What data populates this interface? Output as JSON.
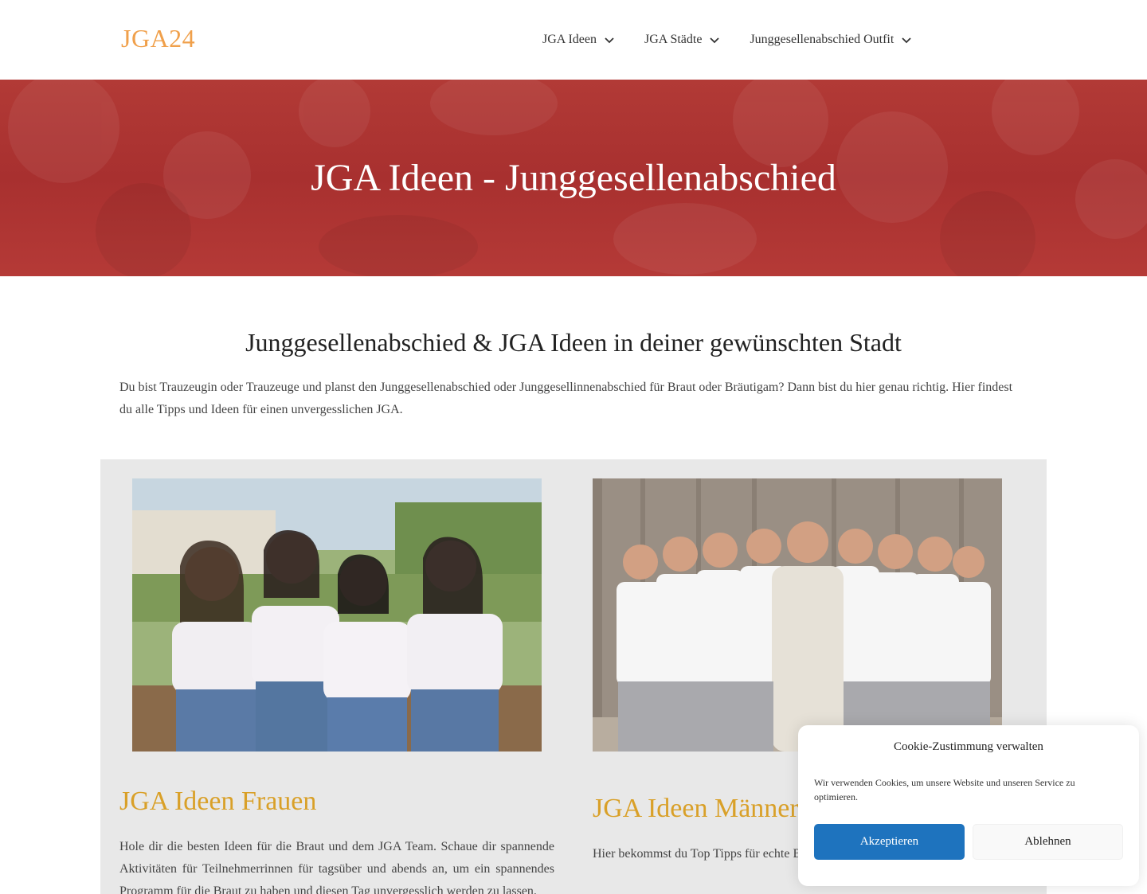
{
  "header": {
    "logo": "JGA24",
    "nav": [
      {
        "label": "JGA Ideen"
      },
      {
        "label": "JGA Städte"
      },
      {
        "label": "Junggesellenabschied Outfit"
      }
    ]
  },
  "hero": {
    "title": "JGA Ideen - Junggesellenabschied"
  },
  "intro": {
    "title": "Junggesellenabschied & JGA Ideen in deiner gewünschten Stadt",
    "text": "Du bist Trauzeugin oder Trauzeuge und planst den Junggesellenabschied oder Junggesellinnenabschied für Braut oder Bräutigam? Dann bist du hier genau richtig. Hier findest du alle Tipps und Ideen für einen unvergesslichen JGA."
  },
  "cards": [
    {
      "heading": "JGA Ideen Frauen",
      "text": "Hole dir die besten Ideen für die Braut und dem JGA Team. Schaue dir spannende Aktivitäten für Teilnehmerrinnen für tagsüber und abends an, um ein spannendes Programm für die Braut zu haben und diesen Tag unvergesslich werden zu lassen."
    },
    {
      "heading": "JGA Ideen Männer",
      "text": "Hier bekommst du Top Tipps für echte Bräutigam legendär zu machen und ei"
    }
  ],
  "cookie": {
    "title": "Cookie-Zustimmung verwalten",
    "text": "Wir verwenden Cookies, um unsere Website und unseren Service zu optimieren.",
    "accept": "Akzeptieren",
    "deny": "Ablehnen"
  },
  "colors": {
    "logo": "#f0a04b",
    "hero": "#a8302f",
    "card_heading": "#d9a028",
    "accept_button": "#1e73be"
  }
}
